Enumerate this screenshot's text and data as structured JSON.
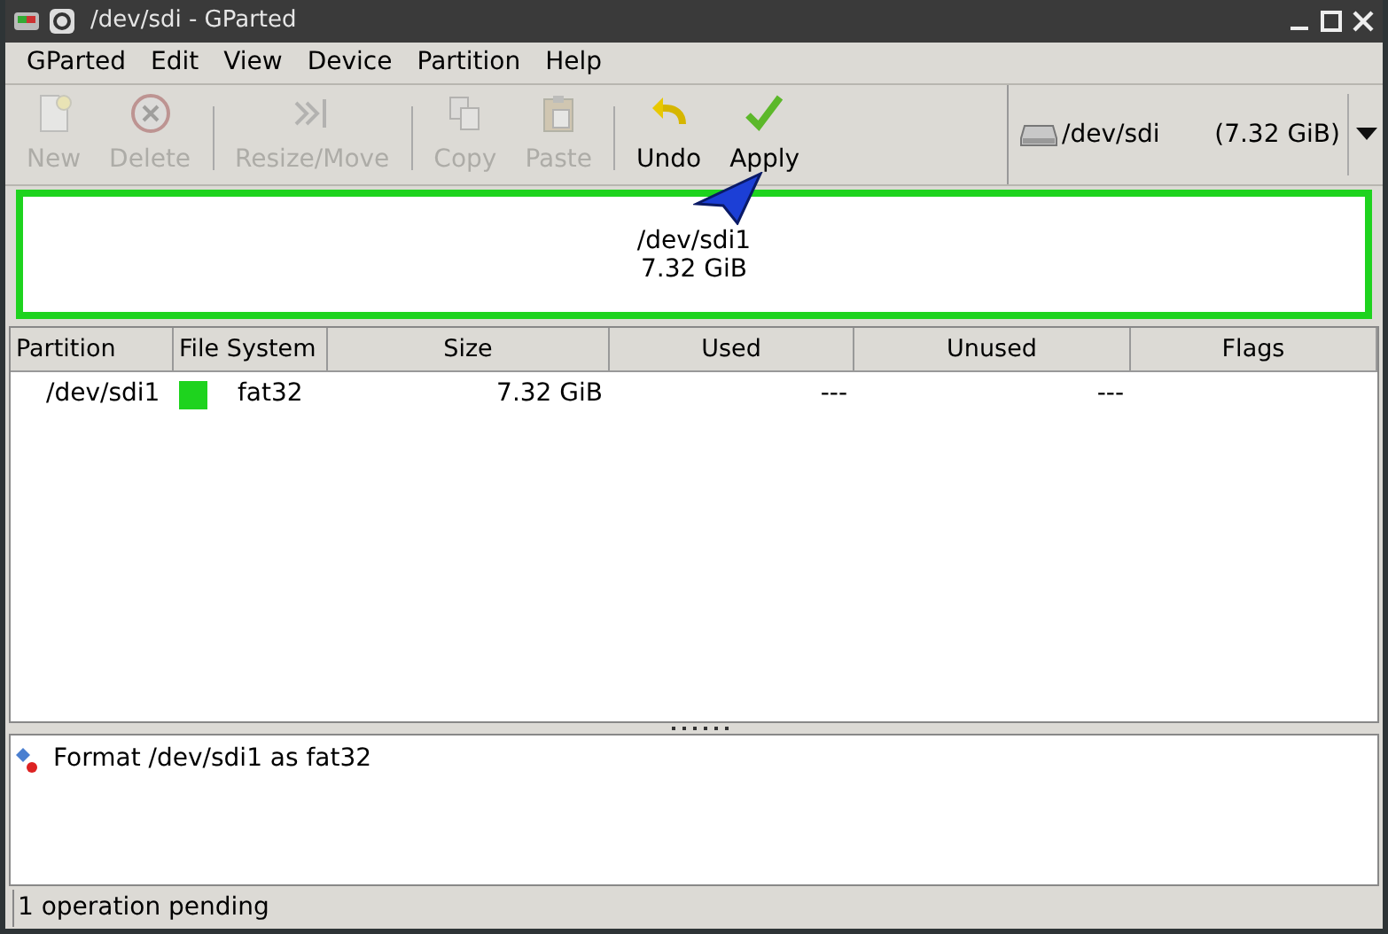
{
  "window": {
    "title": "/dev/sdi - GParted"
  },
  "menu": [
    "GParted",
    "Edit",
    "View",
    "Device",
    "Partition",
    "Help"
  ],
  "toolbar": [
    {
      "kind": "new",
      "label": "New",
      "disabled": true
    },
    {
      "kind": "delete",
      "label": "Delete",
      "disabled": true
    },
    {
      "kind": "separator"
    },
    {
      "kind": "resize",
      "label": "Resize/Move",
      "disabled": true
    },
    {
      "kind": "separator"
    },
    {
      "kind": "copy",
      "label": "Copy",
      "disabled": true
    },
    {
      "kind": "paste",
      "label": "Paste",
      "disabled": true
    },
    {
      "kind": "separator"
    },
    {
      "kind": "undo",
      "label": "Undo",
      "disabled": false
    },
    {
      "kind": "apply",
      "label": "Apply",
      "disabled": false
    }
  ],
  "device": {
    "name": "/dev/sdi",
    "size": "(7.32 GiB)"
  },
  "disk_map": [
    {
      "name": "/dev/sdi1",
      "size": "7.32 GiB",
      "color": "#1ed31e"
    }
  ],
  "table": {
    "columns": [
      "Partition",
      "File System",
      "Size",
      "Used",
      "Unused",
      "Flags"
    ],
    "rows": [
      {
        "partition": "/dev/sdi1",
        "color": "#1ed31e",
        "file_system": "fat32",
        "size": "7.32 GiB",
        "used": "---",
        "unused": "---",
        "flags": ""
      }
    ]
  },
  "operations": [
    "Format /dev/sdi1 as fat32"
  ],
  "status_bar": "1 operation pending"
}
